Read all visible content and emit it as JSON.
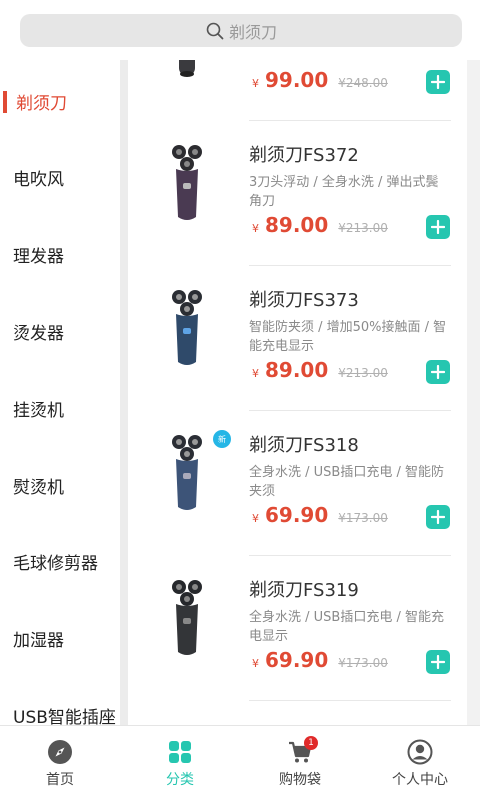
{
  "search": {
    "placeholder": "剃须刀"
  },
  "sidebar": {
    "items": [
      {
        "label": "剃须刀",
        "active": true
      },
      {
        "label": "电吹风"
      },
      {
        "label": "理发器"
      },
      {
        "label": "烫发器"
      },
      {
        "label": "挂烫机"
      },
      {
        "label": "熨烫机"
      },
      {
        "label": "毛球修剪器"
      },
      {
        "label": "加湿器"
      },
      {
        "label": "USB智能插座"
      }
    ]
  },
  "products": [
    {
      "name": "",
      "desc": "",
      "currency": "¥",
      "price": "99.00",
      "old_price": "¥248.00"
    },
    {
      "name": "剃须刀FS372",
      "desc": "3刀头浮动 / 全身水洗 / 弹出式鬓角刀",
      "currency": "¥",
      "price": "89.00",
      "old_price": "¥213.00"
    },
    {
      "name": "剃须刀FS373",
      "desc": "智能防夹须 / 增加50%接触面 / 智能充电显示",
      "currency": "¥",
      "price": "89.00",
      "old_price": "¥213.00"
    },
    {
      "name": "剃须刀FS318",
      "desc": "全身水洗 / USB插口充电 / 智能防夹须",
      "currency": "¥",
      "price": "69.90",
      "old_price": "¥173.00",
      "badge": "新"
    },
    {
      "name": "剃须刀FS319",
      "desc": "全身水洗 / USB插口充电 / 智能充电显示",
      "currency": "¥",
      "price": "69.90",
      "old_price": "¥173.00"
    }
  ],
  "tabbar": {
    "tabs": [
      {
        "label": "首页",
        "icon": "compass-icon"
      },
      {
        "label": "分类",
        "icon": "grid-icon",
        "active": true
      },
      {
        "label": "购物袋",
        "icon": "cart-icon",
        "badge": "1"
      },
      {
        "label": "个人中心",
        "icon": "user-icon"
      }
    ]
  },
  "colors": {
    "accent": "#26c6b0",
    "price": "#e04a34",
    "badge": "#e02a2a",
    "new_badge": "#25b6e6"
  }
}
